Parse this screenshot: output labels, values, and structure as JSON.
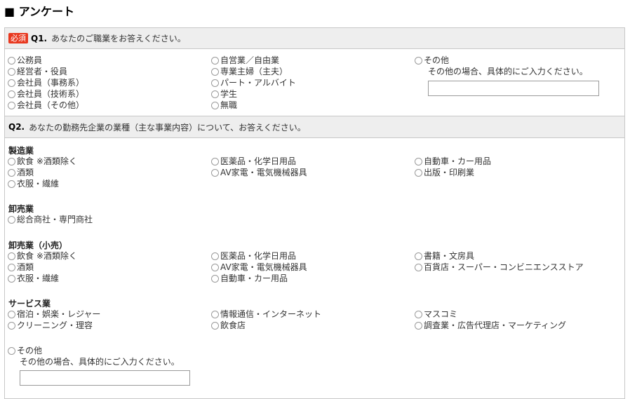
{
  "page": {
    "title": "■ アンケート"
  },
  "q1": {
    "required_label": "必須",
    "number": "Q1.",
    "text": "あなたのご職業をお答えください。",
    "columns": [
      [
        "公務員",
        "経営者・役員",
        "会社員（事務系）",
        "会社員（技術系）",
        "会社員（その他）"
      ],
      [
        "自営業／自由業",
        "専業主婦（主夫）",
        "パート・アルバイト",
        "学生",
        "無職"
      ],
      [
        "その他"
      ]
    ],
    "other_hint": "その他の場合、具体的にご入力ください。",
    "other_value": ""
  },
  "q2": {
    "number": "Q2.",
    "text": "あなたの勤務先企業の業種（主な事業内容）について、お答えください。",
    "categories": [
      {
        "name": "製造業",
        "columns": [
          [
            "飲食 ※酒類除く",
            "酒類",
            "衣服・繊維"
          ],
          [
            "医薬品・化学日用品",
            "AV家電・電気機械器具"
          ],
          [
            "自動車・カー用品",
            "出版・印刷業"
          ]
        ]
      },
      {
        "name": "卸売業",
        "columns": [
          [
            "総合商社・専門商社"
          ],
          [],
          []
        ]
      },
      {
        "name": "卸売業（小売）",
        "columns": [
          [
            "飲食 ※酒類除く",
            "酒類",
            "衣服・繊維"
          ],
          [
            "医薬品・化学日用品",
            "AV家電・電気機械器具",
            "自動車・カー用品"
          ],
          [
            "書籍・文房具",
            "百貨店・スーパー・コンビニエンスストア"
          ]
        ]
      },
      {
        "name": "サービス業",
        "columns": [
          [
            "宿泊・娯楽・レジャー",
            "クリーニング・理容"
          ],
          [
            "情報通信・インターネット",
            "飲食店"
          ],
          [
            "マスコミ",
            "調査業・広告代理店・マーケティング"
          ]
        ]
      }
    ],
    "other_label": "その他",
    "other_hint": "その他の場合、具体的にご入力ください。",
    "other_value": ""
  }
}
